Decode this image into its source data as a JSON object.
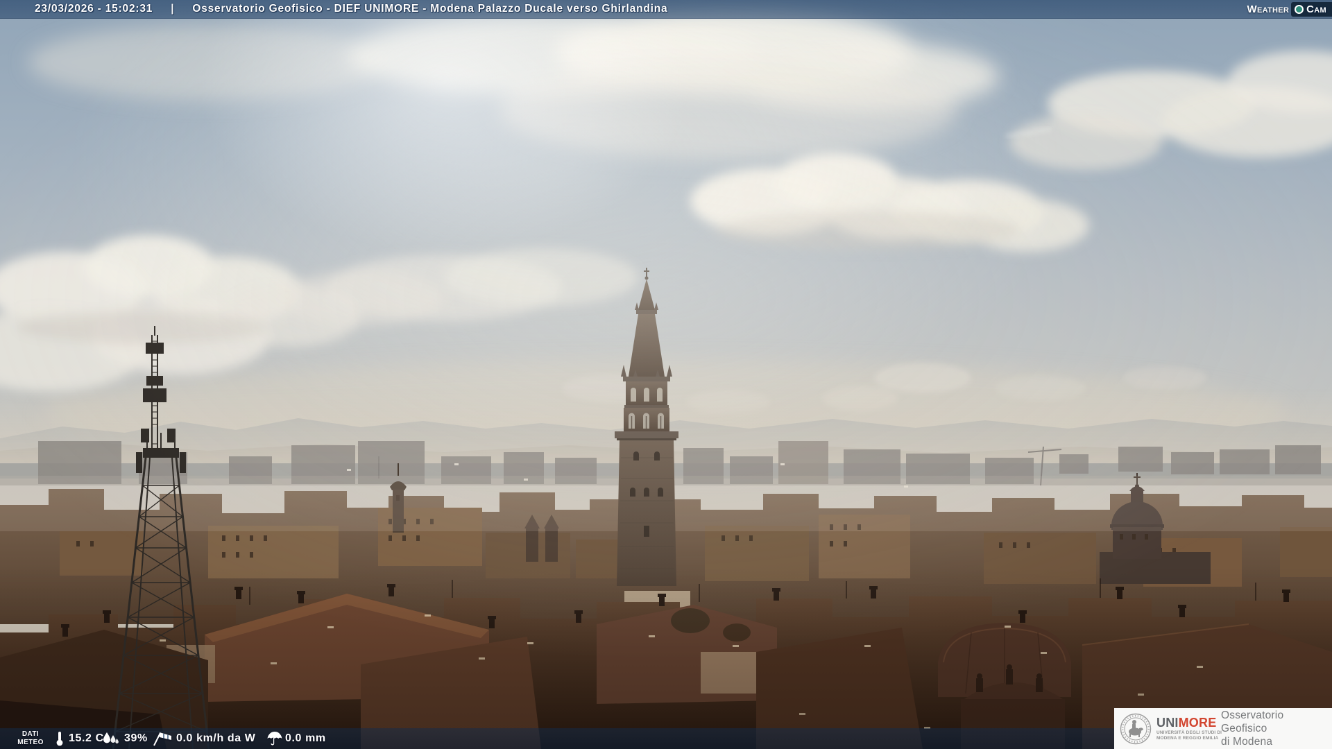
{
  "header": {
    "datetime": "23/03/2026 - 15:02:31",
    "separator": "|",
    "title": "Osservatorio Geofisico - DIEF UNIMORE - Modena Palazzo Ducale verso Ghirlandina"
  },
  "watermark": {
    "weather": "Weather",
    "cam": "Cam"
  },
  "meteo": {
    "label_line1": "DATI",
    "label_line2": "METEO",
    "temperature": "15.2 C",
    "humidity": "39%",
    "wind": "0.0 km/h da W",
    "rain": "0.0 mm"
  },
  "branding": {
    "unimore_uni": "UNI",
    "unimore_more": "MORE",
    "university_line1": "UNIVERSITÀ DEGLI STUDI DI",
    "university_line2": "MODENA E REGGIO EMILIA",
    "observatory_line1": "Osservatorio Geofisico",
    "observatory_line2": "di Modena"
  },
  "colors": {
    "top_bar_blue": "#2c4a6e",
    "bottom_bar_blue": "#102c4c",
    "cam_badge_navy": "#16293d",
    "lens_teal": "#2f8d7c",
    "unimore_grey": "#5d6064",
    "unimore_red": "#d2452f",
    "observatory_text_grey": "#76787a",
    "overlay_text": "#ffffff"
  }
}
